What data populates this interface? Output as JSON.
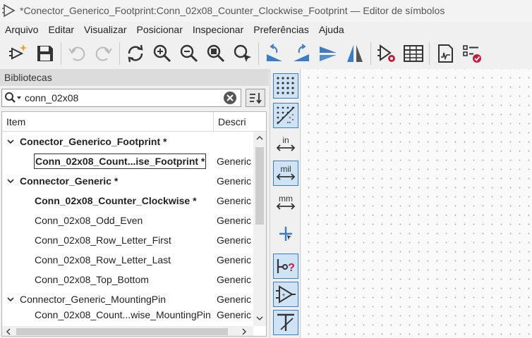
{
  "window": {
    "title": "*Conector_Generico_Footprint:Conn_02x08_Counter_Clockwise_Footprint — Editor de símbolos"
  },
  "menu": [
    "Arquivo",
    "Editar",
    "Visualizar",
    "Posicionar",
    "Inspecionar",
    "Preferências",
    "Ajuda"
  ],
  "toolbar": {
    "icons": [
      "new-symbol-icon",
      "save-icon",
      "undo-icon",
      "redo-icon",
      "refresh-icon",
      "zoom-in-icon",
      "zoom-out-icon",
      "zoom-fit-icon",
      "zoom-selection-icon",
      "rotate-ccw-icon",
      "rotate-cw-icon",
      "mirror-vertical-icon",
      "mirror-horizontal-icon",
      "symbol-properties-icon",
      "pin-table-icon",
      "datasheet-icon",
      "symbol-checker-icon"
    ]
  },
  "libraries": {
    "header": "Bibliotecas",
    "search_value": "conn_02x08",
    "columns": {
      "item": "Item",
      "description": "Descri"
    },
    "rows": [
      {
        "name": "Conector_Generico_Footprint *",
        "desc": "",
        "level": 0,
        "expanded": true,
        "bold": true
      },
      {
        "name": "Conn_02x08_Count...ise_Footprint *",
        "desc": "Generic",
        "level": 1,
        "bold": true,
        "selected": true
      },
      {
        "name": "Connector_Generic *",
        "desc": "Generic",
        "level": 0,
        "expanded": true,
        "bold": true
      },
      {
        "name": "Conn_02x08_Counter_Clockwise *",
        "desc": "Generic",
        "level": 1,
        "bold": true
      },
      {
        "name": "Conn_02x08_Odd_Even",
        "desc": "Generic",
        "level": 1,
        "bold": false
      },
      {
        "name": "Conn_02x08_Row_Letter_First",
        "desc": "Generic",
        "level": 1,
        "bold": false
      },
      {
        "name": "Conn_02x08_Row_Letter_Last",
        "desc": "Generic",
        "level": 1,
        "bold": false
      },
      {
        "name": "Conn_02x08_Top_Bottom",
        "desc": "Generic",
        "level": 1,
        "bold": false
      },
      {
        "name": "Connector_Generic_MountingPin",
        "desc": "Generic",
        "level": 0,
        "expanded": true,
        "bold": false
      },
      {
        "name": "Conn_02x08_Count...wise_MountingPin",
        "desc": "Generic",
        "level": 1,
        "bold": false
      }
    ]
  },
  "left_toolbar": {
    "units_inch": "in",
    "units_mil": "mil",
    "units_mm": "mm"
  },
  "colors": {
    "accent_blue": "#3b7cc3",
    "toggle_bg": "#cfe3f7",
    "canvas_bg": "#fafafa",
    "delete_red": "#c0203c"
  }
}
